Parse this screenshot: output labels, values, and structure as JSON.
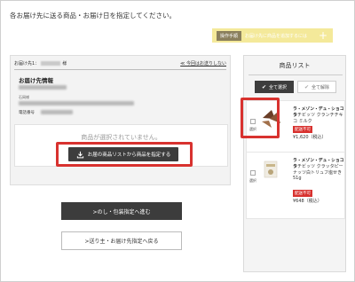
{
  "page": {
    "instruction": "各お届け先に送る商品・お届け日を指定してください。"
  },
  "help": {
    "tag": "操作手順",
    "text": "お届け先に商品を追加するには",
    "plus": "+"
  },
  "destination": {
    "label": "お届け先1：",
    "honorific": "様",
    "back_link": "≪ 今回はお送りしない",
    "info_title": "お届け先情報",
    "name_label": "石岡",
    "email_label": "石岡様",
    "phone_label": "電話番号"
  },
  "product_area": {
    "empty_text": "商品が選択されていません。",
    "pick_button": "お届の商品リストから商品を指定する"
  },
  "actions": {
    "next_button": ">のし・包装指定へ進む",
    "back_button": ">送り主・お届け先指定へ戻る"
  },
  "product_list": {
    "title": "商品リスト",
    "select_all": "全て選択",
    "clear_all": "全て解除",
    "check_mark": "✔",
    "items": [
      {
        "checkbox_label": "選択",
        "brand": "ラ・メゾン・デュ・ショコラ",
        "name": "タチビッツ クランチチキコ ミルク",
        "badge": "配送不可",
        "price": "¥1,620（税込）"
      },
      {
        "checkbox_label": "選択",
        "brand": "ラ・メゾン・デュ・ショコラ",
        "name": "タチビッツ クラッタピーナッツ白トリュフ塩せき 51g",
        "badge": "配送不可",
        "price": "¥648（税込）"
      }
    ]
  },
  "colors": {
    "highlight": "#d8322f",
    "dark_button": "#3c3c3c",
    "help_bar": "#f4e99a"
  }
}
